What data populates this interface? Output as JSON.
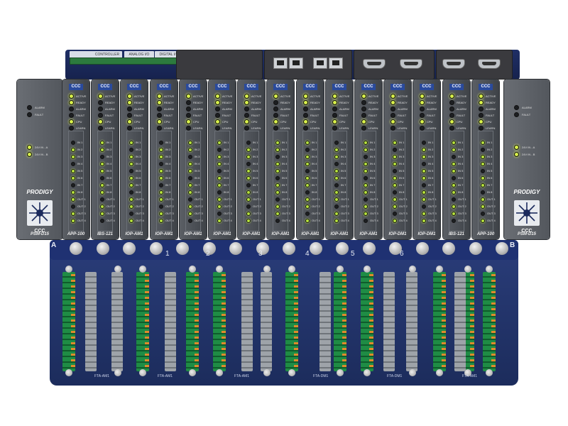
{
  "photo": {
    "top_labels": [
      "CONTROLLER",
      "ANALOG I/O",
      "DIGITAL I/O"
    ],
    "psm_left": {
      "alarm": "ALARM",
      "fault": "FAULT",
      "v_a": "24V IN - A",
      "v_b": "24V IN - B",
      "brand": "PRODIGY",
      "logo": "CCC",
      "name": "PSM-D15"
    },
    "psm_right": {
      "alarm": "ALARM",
      "fault": "FAULT",
      "v_a": "24V IN - A",
      "v_b": "24V IN - B",
      "brand": "PRODIGY",
      "logo": "CCC",
      "name": "PSM-D15"
    },
    "module_badge": "CCC",
    "status_labels": [
      "ACTIVE",
      "READY",
      "ALARM",
      "FAULT",
      "CPU",
      "LEARN"
    ],
    "io_labels": [
      "IN 1",
      "IN 2",
      "IN 3",
      "IN 4",
      "IN 5",
      "IN 6",
      "IN 7",
      "IN 8",
      "OUT 1",
      "OUT 2",
      "OUT 3",
      "OUT 4"
    ],
    "modules": [
      {
        "name": "APP-100"
      },
      {
        "name": "IBS-121"
      },
      {
        "name": "IOP-AM1"
      },
      {
        "name": "IOP-AM1"
      },
      {
        "name": "IOP-AM1"
      },
      {
        "name": "IOP-AM1"
      },
      {
        "name": "IOP-AM1"
      },
      {
        "name": "IOP-AM1"
      },
      {
        "name": "IOP-AM1"
      },
      {
        "name": "IOP-AM1"
      },
      {
        "name": "IOP-AM1"
      },
      {
        "name": "IOP-DM1"
      },
      {
        "name": "IOP-DM1"
      },
      {
        "name": "IBS-121"
      },
      {
        "name": "APP-100"
      }
    ],
    "slot_letters": {
      "left": "A",
      "right": "B"
    },
    "slot_numbers": [
      "1",
      "2",
      "3",
      "4",
      "5",
      "6"
    ],
    "fta_labels": [
      "FTA-AM1",
      "FTA-AM1",
      "FTA-AM1",
      "FTA-DM1",
      "FTA-DM1",
      "FTA-AM1"
    ]
  }
}
